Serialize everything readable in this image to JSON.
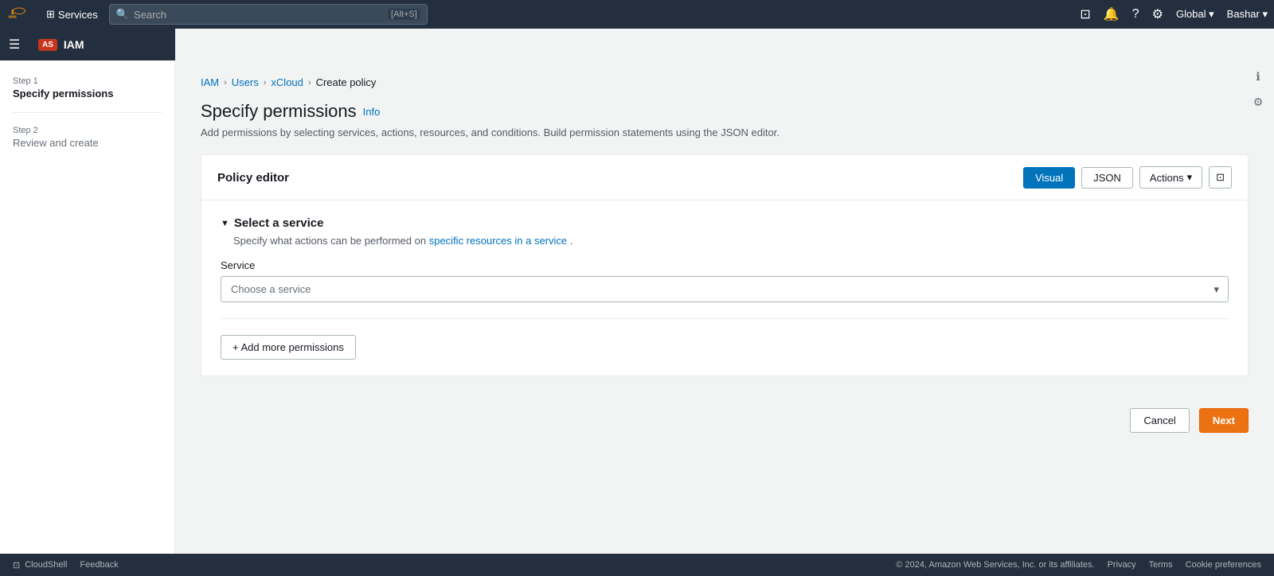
{
  "aws": {
    "logo_text": "aws"
  },
  "topnav": {
    "services_label": "Services",
    "search_placeholder": "Search",
    "search_shortcut": "[Alt+S]",
    "global_label": "Global ▾",
    "user_label": "Bashar ▾"
  },
  "service": {
    "badge": "AS",
    "name": "IAM"
  },
  "breadcrumb": {
    "items": [
      "IAM",
      "Users",
      "xCloud",
      "Create policy"
    ]
  },
  "steps": {
    "step1": {
      "label": "Step 1",
      "name": "Specify permissions"
    },
    "step2": {
      "label": "Step 2",
      "name": "Review and create"
    }
  },
  "page": {
    "title": "Specify permissions",
    "info_link": "Info",
    "description": "Add permissions by selecting services, actions, resources, and conditions. Build permission statements using the JSON editor."
  },
  "policy_editor": {
    "title": "Policy editor",
    "visual_label": "Visual",
    "json_label": "JSON",
    "actions_label": "Actions",
    "actions_arrow": "▾"
  },
  "select_service": {
    "section_title": "Select a service",
    "description_text": "Specify what actions can be performed on",
    "description_link": "specific resources in a service",
    "description_end": ".",
    "service_label": "Service",
    "service_placeholder": "Choose a service"
  },
  "add_permissions": {
    "label": "+ Add more permissions"
  },
  "actions": {
    "cancel_label": "Cancel",
    "next_label": "Next"
  },
  "footer": {
    "cloudshell_label": "CloudShell",
    "feedback_label": "Feedback",
    "copyright": "© 2024, Amazon Web Services, Inc. or its affiliates.",
    "privacy_label": "Privacy",
    "terms_label": "Terms",
    "cookie_label": "Cookie preferences"
  }
}
